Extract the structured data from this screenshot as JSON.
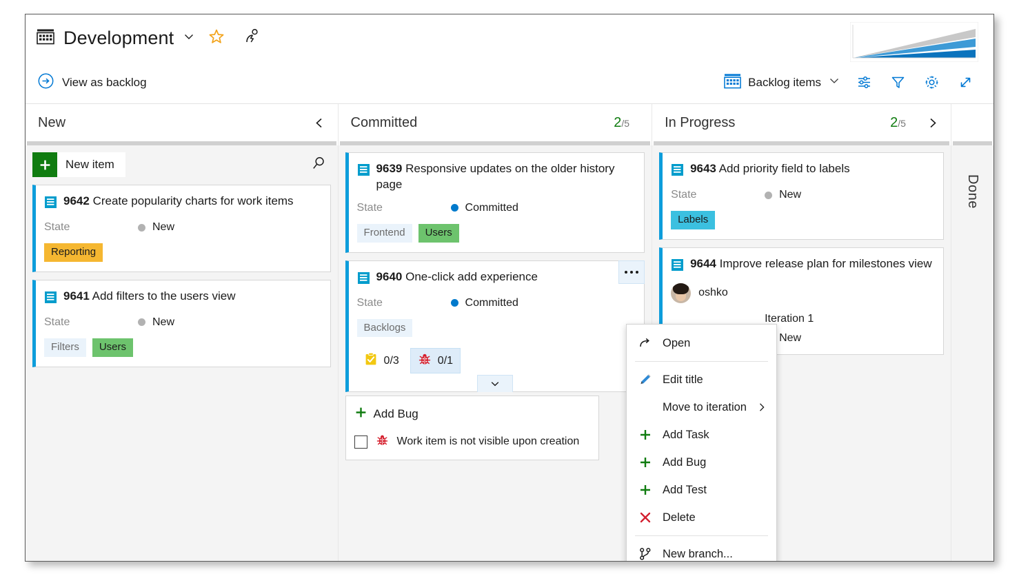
{
  "header": {
    "board_icon": "board-grid-icon",
    "title": "Development",
    "chevron": "chevron-down-icon",
    "favorite_icon": "star-icon",
    "team_icon": "people-icon",
    "cfd_icon": "cumulative-flow-chart"
  },
  "commandbar": {
    "view_as_backlog": "View as backlog",
    "view_as_backlog_icon": "arrow-circle-right-icon",
    "level_selector": {
      "icon": "board-grid-icon",
      "label": "Backlog items",
      "chevron": "chevron-down-icon"
    },
    "buttons": [
      {
        "name": "board-settings-sliders-button",
        "icon": "sliders-icon"
      },
      {
        "name": "filter-button",
        "icon": "funnel-icon"
      },
      {
        "name": "settings-button",
        "icon": "gear-icon"
      },
      {
        "name": "fullscreen-button",
        "icon": "expand-diagonal-icon"
      }
    ]
  },
  "columns": [
    {
      "name": "New",
      "wip_current": "",
      "wip_limit": "",
      "collapse_icon": "chevron-left-icon",
      "collapsed": false,
      "new_item": {
        "label": "New item",
        "icon": "plus-icon"
      },
      "search_icon": "search-icon",
      "cards": [
        {
          "id": "9642",
          "title": "Create popularity charts for work items",
          "icon": "backlog-item-icon",
          "field_label": "State",
          "state": "New",
          "state_dot": "gray",
          "tags": [
            {
              "text": "Reporting",
              "style": "amber"
            }
          ]
        },
        {
          "id": "9641",
          "title": "Add filters to the users view",
          "icon": "backlog-item-icon",
          "field_label": "State",
          "state": "New",
          "state_dot": "gray",
          "tags": [
            {
              "text": "Filters",
              "style": "plain"
            },
            {
              "text": "Users",
              "style": "green"
            }
          ]
        }
      ]
    },
    {
      "name": "Committed",
      "wip_current": "2",
      "wip_limit": "/5",
      "collapsed": false,
      "cards": [
        {
          "id": "9639",
          "title": "Responsive updates on the older history page",
          "icon": "backlog-item-icon",
          "field_label": "State",
          "state": "Committed",
          "state_dot": "blue",
          "tags": [
            {
              "text": "Frontend",
              "style": "plain"
            },
            {
              "text": "Users",
              "style": "green"
            }
          ]
        },
        {
          "id": "9640",
          "title": "One-click add experience",
          "icon": "backlog-item-icon",
          "field_label": "State",
          "state": "Committed",
          "state_dot": "blue",
          "tags": [
            {
              "text": "Backlogs",
              "style": "plain"
            }
          ],
          "counters": [
            {
              "icon": "task-clipboard-icon",
              "text": "0/3",
              "selected": false
            },
            {
              "icon": "bug-ladybug-icon",
              "text": "0/1",
              "selected": true
            }
          ],
          "expand_icon": "chevron-down-icon",
          "context_button": "card-context-menu-button"
        }
      ],
      "add_panel": {
        "add_label": "Add Bug",
        "add_icon": "plus-icon",
        "checkbox_label": "Work item is not visible upon creation",
        "checkbox_icon": "bug-ladybug-icon",
        "checked": false
      }
    },
    {
      "name": "In Progress",
      "wip_current": "2",
      "wip_limit": "/5",
      "expand_icon": "chevron-right-icon",
      "collapsed": false,
      "cards": [
        {
          "id": "9643",
          "title": "Add priority field to labels",
          "icon": "backlog-item-icon",
          "field_label": "State",
          "state": "New",
          "state_dot": "gray",
          "tags": [
            {
              "text": "Labels",
              "style": "cyan"
            }
          ]
        },
        {
          "id": "9644",
          "title": "Improve release plan for milestones view",
          "icon": "backlog-item-icon",
          "assignee": "oshko",
          "avatar": "user-avatar",
          "iteration": "Iteration 1",
          "state": "New",
          "state_dot": "gray"
        }
      ]
    },
    {
      "name": "Done",
      "collapsed": true
    }
  ],
  "context_menu": {
    "items": [
      {
        "label": "Open",
        "icon": "open-arrow-icon",
        "type": "item"
      },
      {
        "type": "separator"
      },
      {
        "label": "Edit title",
        "icon": "pencil-icon",
        "type": "item"
      },
      {
        "label": "Move to iteration",
        "icon": "",
        "type": "item",
        "submenu": "chevron-right-icon"
      },
      {
        "label": "Add Task",
        "icon": "plus-icon",
        "type": "item"
      },
      {
        "label": "Add Bug",
        "icon": "plus-icon",
        "type": "item"
      },
      {
        "label": "Add Test",
        "icon": "plus-icon",
        "type": "item"
      },
      {
        "label": "Delete",
        "icon": "x-icon",
        "type": "item"
      },
      {
        "type": "separator"
      },
      {
        "label": "New branch...",
        "icon": "branch-icon",
        "type": "item"
      }
    ]
  },
  "colors": {
    "accent": "#0078d4",
    "card_stripe": "#0d9ddb",
    "wip_ok": "#107c10",
    "tag_green": "#6dc36d",
    "tag_amber": "#f5b731",
    "tag_cyan": "#3bc0e0",
    "bug_red": "#d5202e",
    "task_yellow": "#f2c811"
  }
}
